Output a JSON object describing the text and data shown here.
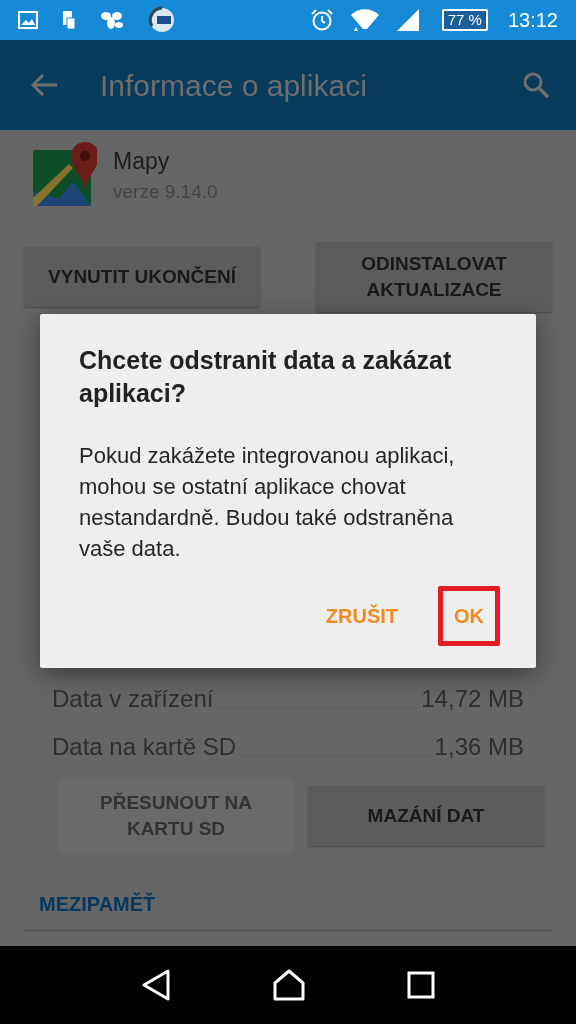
{
  "status_bar": {
    "battery": "77 %",
    "time": "13:12"
  },
  "toolbar": {
    "title": "Informace o aplikaci"
  },
  "app": {
    "name": "Mapy",
    "version": "verze 9.14.0"
  },
  "top_buttons": [
    {
      "label": "VYNUTIT UKONČENÍ",
      "disabled": false
    },
    {
      "label": "ODINSTALOVAT AKTUALIZACE",
      "disabled": false
    }
  ],
  "storage_rows": [
    {
      "label": "Data v zařízení",
      "value": "14,72 MB"
    },
    {
      "label": "Data na kartě SD",
      "value": "1,36 MB"
    }
  ],
  "storage_buttons": [
    {
      "label": "PŘESUNOUT NA KARTU SD",
      "disabled": true
    },
    {
      "label": "MAZÁNÍ DAT",
      "disabled": false
    }
  ],
  "section_header": "MEZIPAMĚŤ",
  "dialog": {
    "title": "Chcete odstranit data a zakázat aplikaci?",
    "message": "Pokud zakážete integrovanou aplikaci, mohou se ostatní aplikace chovat nestandardně. Budou také odstraněna vaše data.",
    "buttons": [
      {
        "label": "ZRUŠIT",
        "highlighted": false
      },
      {
        "label": "OK",
        "highlighted": true
      }
    ]
  }
}
